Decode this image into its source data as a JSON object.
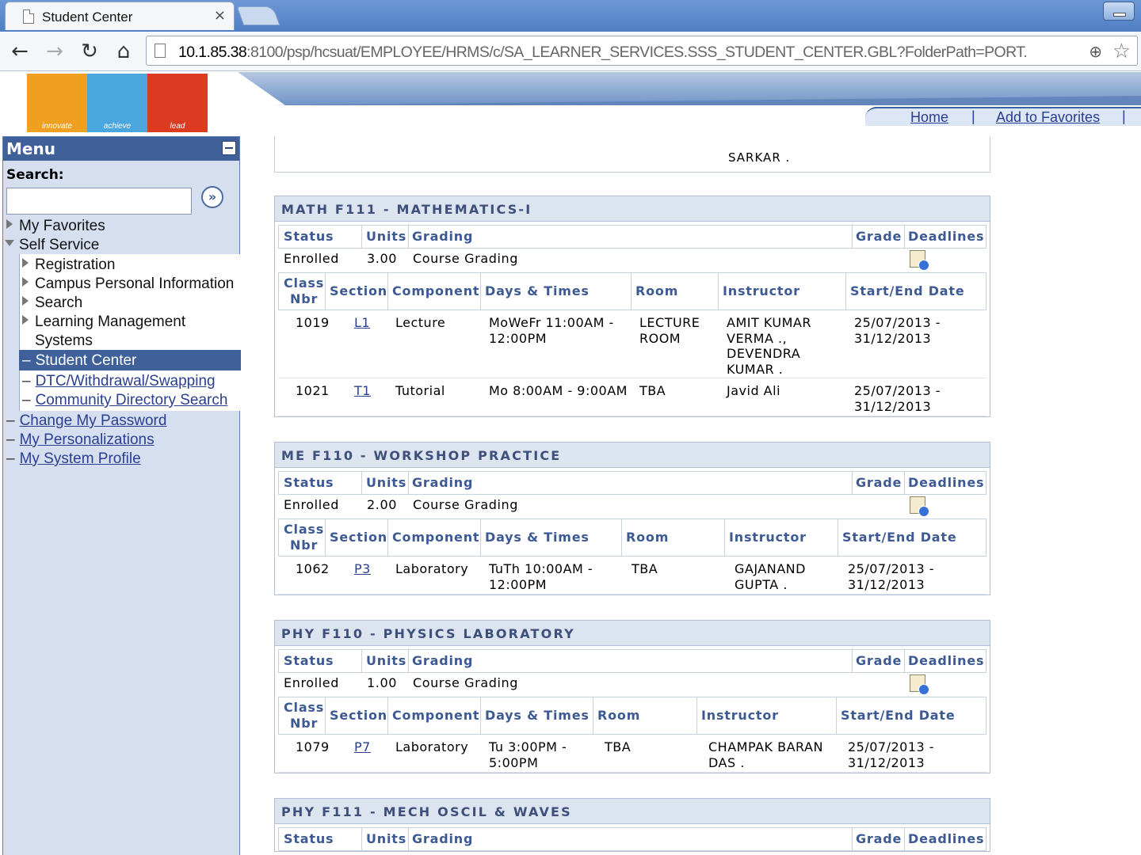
{
  "browser": {
    "tab_title": "Student Center",
    "tab_close": "×",
    "url_host": "10.1.85.38",
    "url_rest": ":8100/psp/hcsuat/EMPLOYEE/HRMS/c/SA_LEARNER_SERVICES.SSS_STUDENT_CENTER.GBL?FolderPath=PORT."
  },
  "header": {
    "logo_labels": [
      "innovate",
      "achieve",
      "lead"
    ],
    "links": [
      "Home",
      "Add to Favorites"
    ]
  },
  "menu": {
    "title": "Menu",
    "search_label": "Search:",
    "search_value": "",
    "go_glyph": "»",
    "items": {
      "my_favorites": "My Favorites",
      "self_service": "Self Service",
      "registration": "Registration",
      "campus_personal": "Campus Personal Information",
      "search": "Search",
      "learning_mgmt_1": "Learning Management",
      "learning_mgmt_2": "Systems",
      "student_center": "Student Center",
      "dtc": "DTC/Withdrawal/Swapping",
      "community_dir": "Community Directory Search",
      "change_password": "Change My Password",
      "personalizations": "My Personalizations",
      "system_profile": "My System Profile"
    }
  },
  "content": {
    "top_stub_text": "SARKAR .",
    "headers": {
      "status": "Status",
      "units": "Units",
      "grading": "Grading",
      "grade": "Grade",
      "deadlines": "Deadlines",
      "class_nbr_1": "Class",
      "class_nbr_2": "Nbr",
      "section": "Section",
      "component": "Component",
      "days_times": "Days & Times",
      "room": "Room",
      "instructor": "Instructor",
      "start_end": "Start/End Date"
    },
    "courses": [
      {
        "title": "MATH F111 - MATHEMATICS-I",
        "status": "Enrolled",
        "units": "3.00",
        "grading": "Course Grading",
        "classes": [
          {
            "nbr": "1019",
            "section": "L1",
            "component": "Lecture",
            "days": "MoWeFr 11:00AM -\n12:00PM",
            "room": "LECTURE\nROOM",
            "instructor": "AMIT KUMAR\nVERMA .,\nDEVENDRA\nKUMAR .",
            "dates": "25/07/2013 -\n31/12/2013"
          },
          {
            "nbr": "1021",
            "section": "T1",
            "component": "Tutorial",
            "days": "Mo 8:00AM - 9:00AM",
            "room": "TBA",
            "instructor": "Javid Ali",
            "dates": "25/07/2013 -\n31/12/2013"
          }
        ]
      },
      {
        "title": "ME F110 - WORKSHOP PRACTICE",
        "status": "Enrolled",
        "units": "2.00",
        "grading": "Course Grading",
        "classes": [
          {
            "nbr": "1062",
            "section": "P3",
            "component": "Laboratory",
            "days": "TuTh 10:00AM -\n12:00PM",
            "room": "TBA",
            "instructor": "GAJANAND\nGUPTA .",
            "dates": "25/07/2013 -\n31/12/2013"
          }
        ]
      },
      {
        "title": "PHY F110 - PHYSICS LABORATORY",
        "status": "Enrolled",
        "units": "1.00",
        "grading": "Course Grading",
        "classes": [
          {
            "nbr": "1079",
            "section": "P7",
            "component": "Laboratory",
            "days": "Tu 3:00PM -\n5:00PM",
            "room": "TBA",
            "instructor": "CHAMPAK BARAN\nDAS .",
            "dates": "25/07/2013 -\n31/12/2013"
          }
        ]
      },
      {
        "title": "PHY F111 - MECH OSCIL & WAVES"
      }
    ]
  }
}
